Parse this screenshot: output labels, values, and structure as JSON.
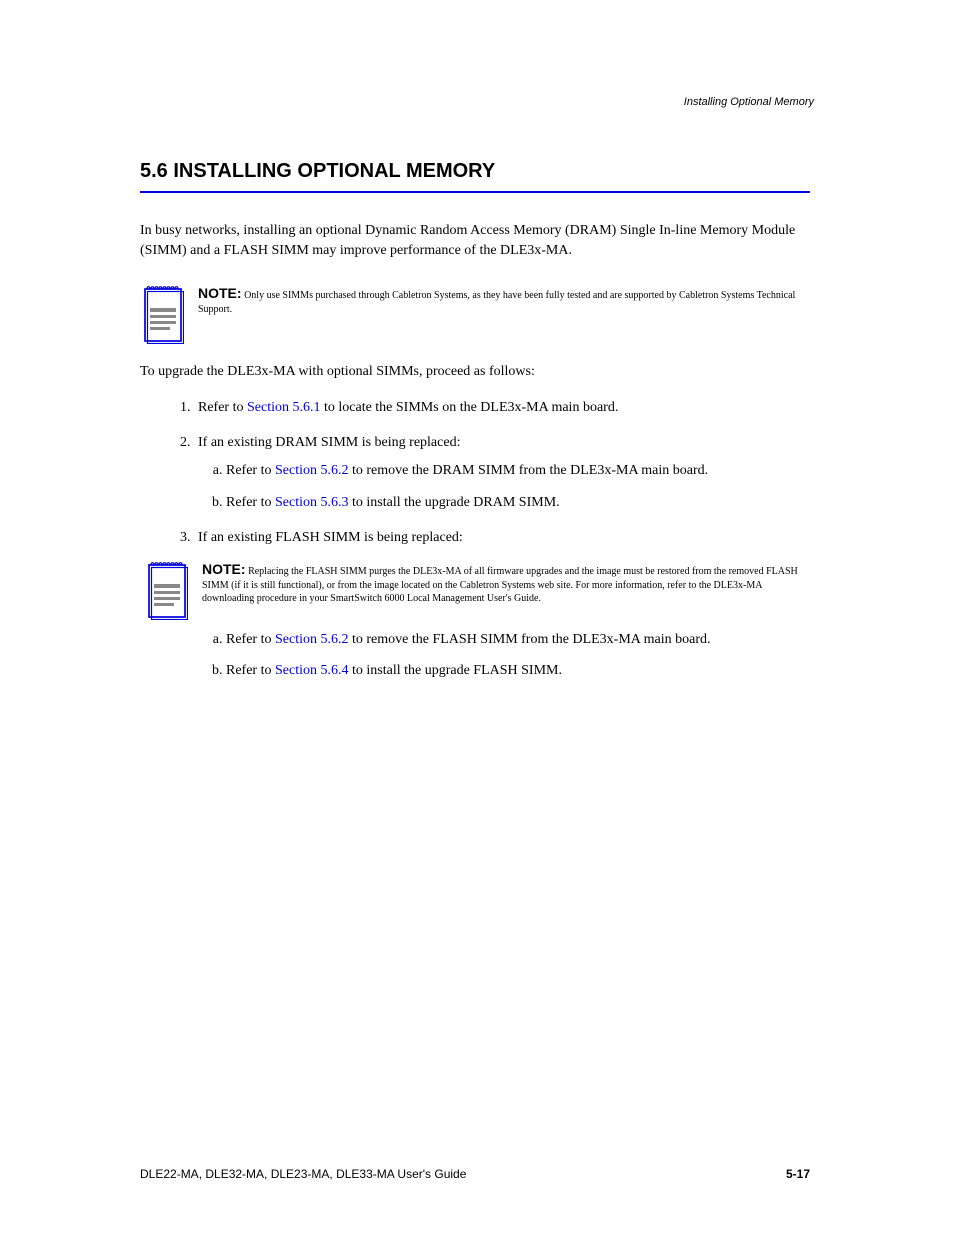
{
  "running_header": "Installing Optional Memory",
  "section": {
    "title": "5.6 INSTALLING OPTIONAL MEMORY",
    "intro": "In busy networks, installing an optional Dynamic Random Access Memory (DRAM) Single In-line Memory Module (SIMM) and a FLASH SIMM may improve performance of the DLE3x-MA.",
    "note1_label": "NOTE:",
    "note1_text": " Only use SIMMs purchased through Cabletron Systems, as they have been fully tested and are supported by Cabletron Systems Technical Support.",
    "steps_lead": "To upgrade the DLE3x-MA with optional SIMMs, proceed as follows:",
    "steps": [
      {
        "text_pre": "Refer to ",
        "link": "Section 5.6.1",
        "text_post": " to locate the SIMMs on the DLE3x-MA main board."
      },
      {
        "text": "If an existing DRAM SIMM is being replaced:",
        "children": [
          {
            "text_pre": "Refer to ",
            "link": "Section 5.6.2",
            "text_post": " to remove the DRAM SIMM from the DLE3x-MA main board."
          },
          {
            "text_pre": "Refer to ",
            "link": "Section 5.6.3",
            "text_post": " to install the upgrade DRAM SIMM."
          }
        ]
      },
      {
        "text": "If an existing FLASH SIMM is being replaced:",
        "note_label": "NOTE:",
        "note_text": " Replacing the FLASH SIMM purges the DLE3x-MA of all firmware upgrades and the image must be restored from the removed FLASH SIMM (if it is still functional), or from the image located on the Cabletron Systems web site. For more information, refer to the DLE3x-MA downloading procedure in your SmartSwitch 6000 Local Management User's Guide.",
        "children": [
          {
            "text_pre": "Refer to ",
            "link": "Section 5.6.2",
            "text_post": " to remove the FLASH SIMM from the DLE3x-MA main board."
          },
          {
            "text_pre": "Refer to ",
            "link": "Section 5.6.4",
            "text_post": " to install the upgrade FLASH SIMM."
          }
        ]
      }
    ]
  },
  "footer": {
    "left": "DLE22-MA, DLE32-MA, DLE23-MA, DLE33-MA User's Guide",
    "right": "5-17"
  }
}
